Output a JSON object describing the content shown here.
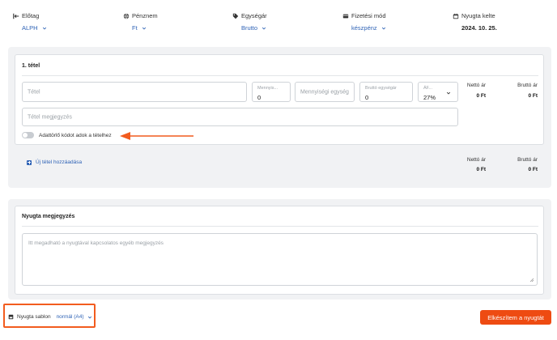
{
  "settings": {
    "prefix": {
      "label": "Előtag",
      "value": "ALPH",
      "icon": "prefix-icon"
    },
    "currency": {
      "label": "Pénznem",
      "value": "Ft",
      "icon": "globe-icon"
    },
    "unit_price": {
      "label": "Egységár",
      "value": "Brutto",
      "icon": "pricetag-icon"
    },
    "payment": {
      "label": "Fizetési mód",
      "value": "készpénz",
      "icon": "payment-card-icon"
    },
    "issue_date": {
      "label": "Nyugta kelte",
      "value": "2024. 10. 25.",
      "icon": "calendar-icon"
    }
  },
  "item": {
    "title": "1. tétel",
    "name_placeholder": "Tétel",
    "quantity_label": "Mennyis...",
    "quantity_value": "0",
    "unit_placeholder": "Mennyiségi egység",
    "gross_unit_price_label": "Bruttó egységár",
    "gross_unit_price_value": "0",
    "vat_label": "ÁF...",
    "vat_value": "27%",
    "net_label": "Nettó ár",
    "net_value": "0 Ft",
    "gross_label": "Bruttó ár",
    "gross_value": "0 Ft",
    "note_placeholder": "Tétel megjegyzés",
    "toggle_label": "Adattörlő kódot adok a tételhez",
    "toggle_on": false
  },
  "add_item": {
    "label": "Új tétel hozzáadása",
    "net_label": "Nettó ár",
    "net_value": "0 Ft",
    "gross_label": "Bruttó ár",
    "gross_value": "0 Ft"
  },
  "receipt_note": {
    "title": "Nyugta megjegyzés",
    "placeholder": "Itt megadható a nyugtával kapcsolatos egyéb megjegyzés"
  },
  "footer": {
    "template_label": "Nyugta sablon",
    "template_value": "normál (A4)",
    "submit_label": "Elkészítem a nyugtát"
  },
  "colors": {
    "accent": "#2f63b6",
    "cta": "#ee4b12",
    "highlight": "#f25c1f"
  }
}
